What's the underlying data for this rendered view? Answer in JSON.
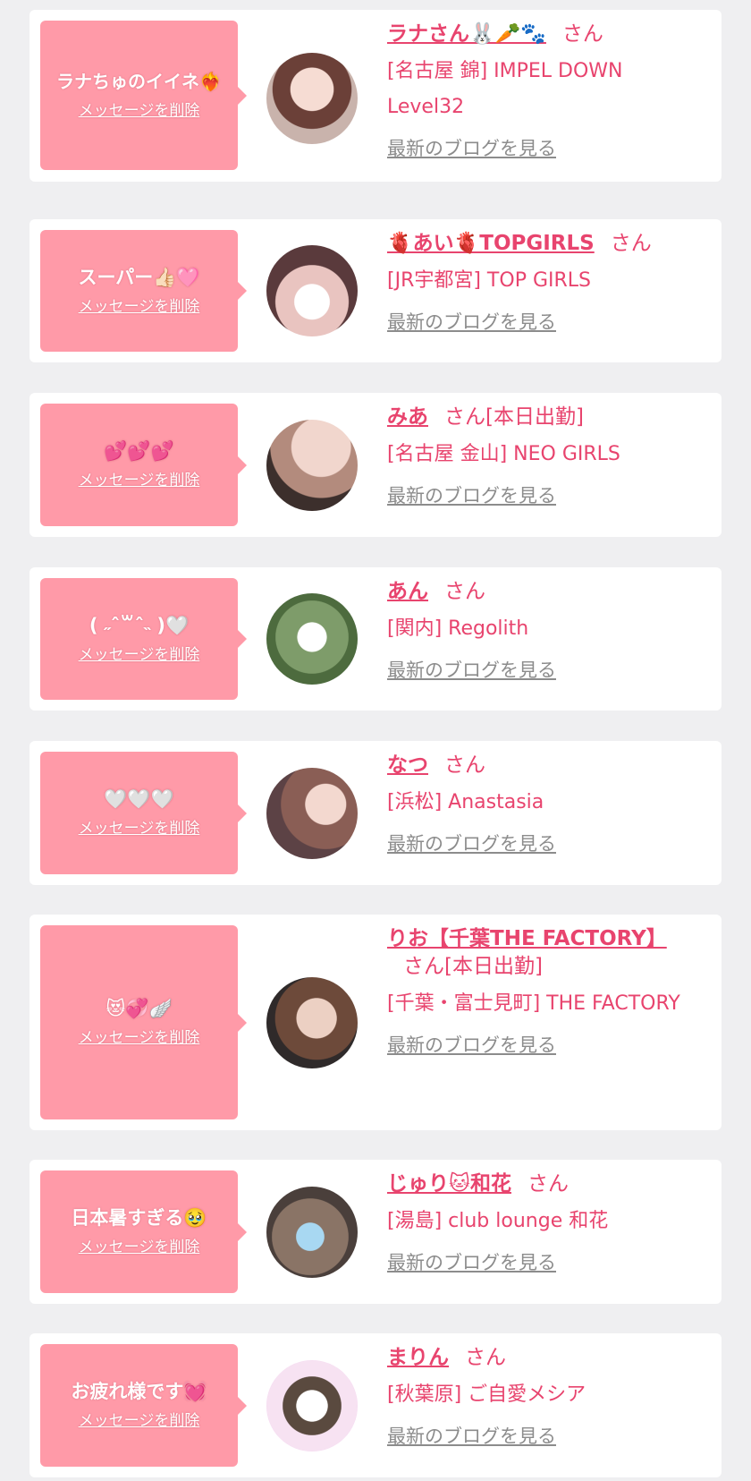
{
  "delete_label": "メッセージを削除",
  "blog_label": "最新のブログを見る",
  "san_label": "さん",
  "colors": {
    "background": "#efeff1",
    "bubble": "#ff9aa8",
    "name": "#e8446e",
    "link_gray": "#8c8c8c"
  },
  "messages": [
    {
      "message": "ラナちゅのイイネ❤️‍🔥",
      "name": "ラナさん🐰🥕🐾",
      "suffix": "",
      "shop": "[名古屋 錦] IMPEL DOWN Level32"
    },
    {
      "message": "スーパー👍🏻🩷",
      "name": "🫀あい🫀TOPGIRLS",
      "suffix": "",
      "shop": "[JR宇都宮] TOP GIRLS"
    },
    {
      "message": "💕💕💕",
      "name": "みあ",
      "suffix": "[本日出勤]",
      "shop": "[名古屋 金山] NEO GIRLS"
    },
    {
      "message": "( ˶ˆ꒳ˆ˵ )🤍",
      "name": "あん",
      "suffix": "",
      "shop": "[関内] Regolith"
    },
    {
      "message": "🤍🤍🤍",
      "name": "なつ",
      "suffix": "",
      "shop": "[浜松] Anastasia"
    },
    {
      "message": "😻💞🪽",
      "name": "りお【千葉THE FACTORY】",
      "suffix": "[本日出勤]",
      "shop": "[千葉・富士見町] THE FACTORY"
    },
    {
      "message": "日本暑すぎる🥹",
      "name": "じゅり🐱和花",
      "suffix": "",
      "shop": "[湯島] club lounge 和花"
    },
    {
      "message": "お疲れ様です💓",
      "name": "まりん",
      "suffix": "",
      "shop": "[秋葉原] ご自愛メシア"
    }
  ]
}
